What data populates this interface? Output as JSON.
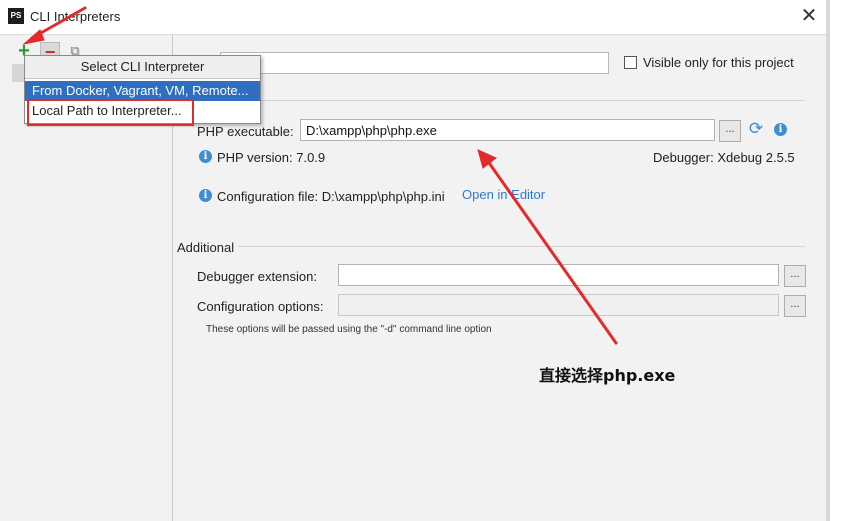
{
  "window": {
    "title": "CLI Interpreters",
    "app_icon": "PS",
    "close_symbol": "✕"
  },
  "toolbar": {
    "add_symbol": "+",
    "remove_symbol": "−",
    "copy_symbol": "⧉"
  },
  "popup": {
    "title": "Select CLI Interpreter",
    "items": [
      {
        "label": "From Docker, Vagrant, VM, Remote...",
        "selected": true
      },
      {
        "label": "Local Path to Interpreter...",
        "selected": false
      }
    ]
  },
  "form": {
    "name_value": "",
    "visible_only_label": "Visible only for this project",
    "visible_only_checked": false,
    "php_executable_label": "PHP executable:",
    "php_executable_value": "D:\\xampp\\php\\php.exe",
    "browse_label": "...",
    "php_version_text": "PHP version: 7.0.9",
    "debugger_text": "Debugger: Xdebug 2.5.5",
    "config_file_text": "Configuration file: D:\\xampp\\php\\php.ini",
    "open_in_editor_link": "Open in Editor"
  },
  "additional": {
    "section_title": "Additional",
    "debugger_extension_label": "Debugger extension:",
    "debugger_extension_value": "",
    "configuration_options_label": "Configuration options:",
    "configuration_options_value": "",
    "hint": "These options will be passed using the \"-d\" command line option"
  },
  "annotation": {
    "text": "直接选择php.exe",
    "color": "#e22b2b"
  },
  "colors": {
    "selection": "#2e6fc2",
    "link": "#2f79c8",
    "info": "#3d8fd1",
    "add": "#2a9d2a",
    "remove": "#d12a2a"
  }
}
